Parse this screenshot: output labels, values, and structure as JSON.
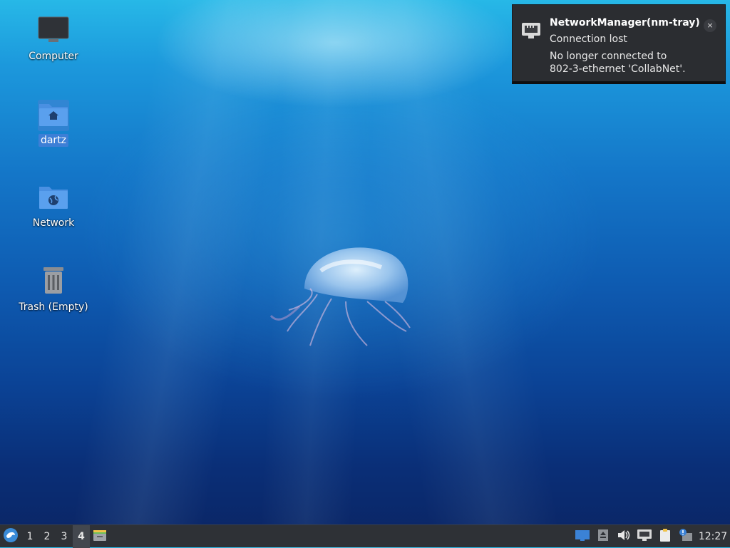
{
  "desktop": {
    "icons": [
      {
        "label": "Computer",
        "icon": "computer-icon"
      },
      {
        "label": "dartz",
        "icon": "home-folder-icon"
      },
      {
        "label": "Network",
        "icon": "network-folder-icon"
      },
      {
        "label": "Trash (Empty)",
        "icon": "trash-icon"
      }
    ]
  },
  "notification": {
    "app": "NetworkManager(nm-tray)",
    "summary": "Connection lost",
    "body_line1": "No longer connected to",
    "body_line2": "802-3-ethernet 'CollabNet'.",
    "close_glyph": "×",
    "icon": "network-wired-icon"
  },
  "panel": {
    "workspaces": [
      "1",
      "2",
      "3",
      "4"
    ],
    "active_workspace": "4",
    "clock": "12:27",
    "tray": [
      "display-icon",
      "notification-area-arrow-icon",
      "volume-icon",
      "network-wired-icon",
      "clipboard-icon",
      "updates-icon"
    ]
  },
  "colors": {
    "panel_bg": "#2e3136",
    "notification_bg": "#2b2d31",
    "selection": "#3d7fd6"
  }
}
